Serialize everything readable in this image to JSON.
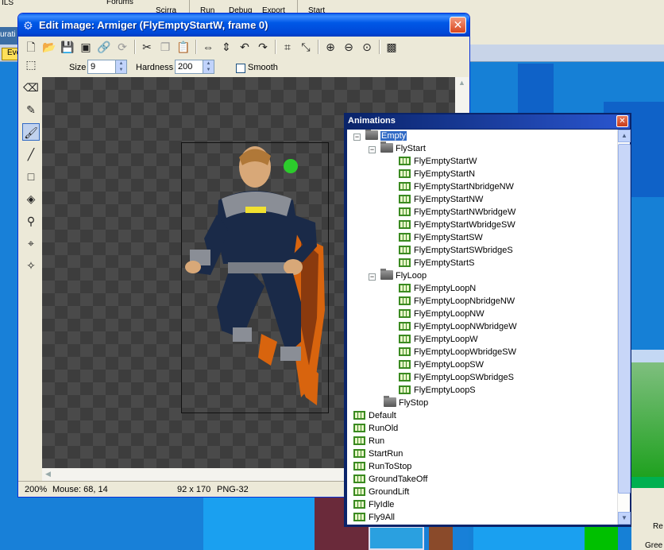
{
  "background_app": {
    "toolbar_items": [
      "Forums",
      "Scirra",
      "Run",
      "Debug",
      "Export",
      "Start"
    ],
    "left_edge_text": "ILS",
    "left_strip_text": "urati",
    "tab_text": "Eve",
    "bottom_right_texts": [
      "Re",
      "Gree"
    ]
  },
  "editor": {
    "title": "Edit image: Armiger (FlyEmptyStartW, frame 0)",
    "close_label": "✕",
    "toolbar_icons": [
      "new-icon",
      "open-icon",
      "save-icon",
      "save-all-icon",
      "link-icon",
      "refresh-icon",
      "cut-icon",
      "copy-icon",
      "paste-icon",
      "flip-horizontal-icon",
      "flip-vertical-icon",
      "rotate-left-icon",
      "rotate-right-icon",
      "crop-icon",
      "resize-icon",
      "zoom-in-icon",
      "zoom-out-icon",
      "zoom-reset-icon",
      "grid-icon"
    ],
    "size_label": "Size",
    "size_value": "9",
    "hardness_label": "Hardness",
    "hardness_value": "200",
    "smooth_label": "Smooth",
    "tools": [
      "select-icon",
      "eraser-icon",
      "pencil-icon",
      "brush-icon",
      "line-icon",
      "rectangle-icon",
      "fill-icon",
      "eyedropper-icon",
      "hotspot-icon",
      "action-point-icon"
    ],
    "active_tool": 3,
    "status": {
      "zoom": "200%",
      "mouse": "Mouse: 68, 14",
      "dimensions": "92 x 170",
      "format": "PNG-32"
    }
  },
  "animations": {
    "title": "Animations",
    "close_label": "✕",
    "tree": [
      {
        "label": "Empty",
        "type": "folder",
        "level": 0,
        "expander": "-",
        "selected": true
      },
      {
        "label": "FlyStart",
        "type": "folder",
        "level": 1,
        "expander": "-"
      },
      {
        "label": "FlyEmptyStartW",
        "type": "anim",
        "level": 2
      },
      {
        "label": "FlyEmptyStartN",
        "type": "anim",
        "level": 2
      },
      {
        "label": "FlyEmptyStartNbridgeNW",
        "type": "anim",
        "level": 2
      },
      {
        "label": "FlyEmptyStartNW",
        "type": "anim",
        "level": 2
      },
      {
        "label": "FlyEmptyStartNWbridgeW",
        "type": "anim",
        "level": 2
      },
      {
        "label": "FlyEmptyStartWbridgeSW",
        "type": "anim",
        "level": 2
      },
      {
        "label": "FlyEmptyStartSW",
        "type": "anim",
        "level": 2
      },
      {
        "label": "FlyEmptyStartSWbridgeS",
        "type": "anim",
        "level": 2
      },
      {
        "label": "FlyEmptyStartS",
        "type": "anim",
        "level": 2
      },
      {
        "label": "FlyLoop",
        "type": "folder",
        "level": 1,
        "expander": "-"
      },
      {
        "label": "FlyEmptyLoopN",
        "type": "anim",
        "level": 2
      },
      {
        "label": "FlyEmptyLoopNbridgeNW",
        "type": "anim",
        "level": 2
      },
      {
        "label": "FlyEmptyLoopNW",
        "type": "anim",
        "level": 2
      },
      {
        "label": "FlyEmptyLoopNWbridgeW",
        "type": "anim",
        "level": 2
      },
      {
        "label": "FlyEmptyLoopW",
        "type": "anim",
        "level": 2
      },
      {
        "label": "FlyEmptyLoopWbridgeSW",
        "type": "anim",
        "level": 2
      },
      {
        "label": "FlyEmptyLoopSW",
        "type": "anim",
        "level": 2
      },
      {
        "label": "FlyEmptyLoopSWbridgeS",
        "type": "anim",
        "level": 2
      },
      {
        "label": "FlyEmptyLoopS",
        "type": "anim",
        "level": 2
      },
      {
        "label": "FlyStop",
        "type": "folder",
        "level": 1
      },
      {
        "label": "Default",
        "type": "anim",
        "level": 0
      },
      {
        "label": "RunOld",
        "type": "anim",
        "level": 0
      },
      {
        "label": "Run",
        "type": "anim",
        "level": 0
      },
      {
        "label": "StartRun",
        "type": "anim",
        "level": 0
      },
      {
        "label": "RunToStop",
        "type": "anim",
        "level": 0
      },
      {
        "label": "GroundTakeOff",
        "type": "anim",
        "level": 0
      },
      {
        "label": "GroundLift",
        "type": "anim",
        "level": 0
      },
      {
        "label": "FlyIdle",
        "type": "anim",
        "level": 0
      },
      {
        "label": "Fly9All",
        "type": "anim",
        "level": 0
      }
    ]
  }
}
